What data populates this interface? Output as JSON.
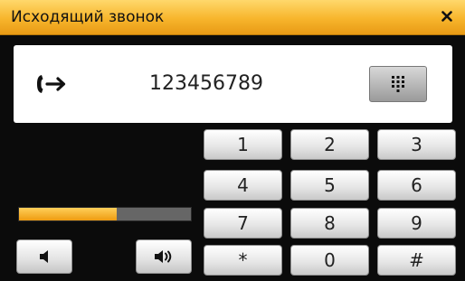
{
  "window": {
    "title": "Исходящий звонок",
    "close_icon": "close-icon"
  },
  "call": {
    "direction_icon": "outgoing-call-icon",
    "number": "123456789",
    "keypad_toggle_icon": "keypad-icon"
  },
  "keypad": {
    "keys": [
      "1",
      "2",
      "3",
      "4",
      "5",
      "6",
      "7",
      "8",
      "9",
      "*",
      "0",
      "#"
    ]
  },
  "volume": {
    "level": 0.57,
    "down_icon": "volume-down-icon",
    "up_icon": "volume-up-icon"
  },
  "colors": {
    "accent": "#f2a820",
    "titlebar_top": "#ffd86b",
    "background": "#0b0b0b"
  }
}
